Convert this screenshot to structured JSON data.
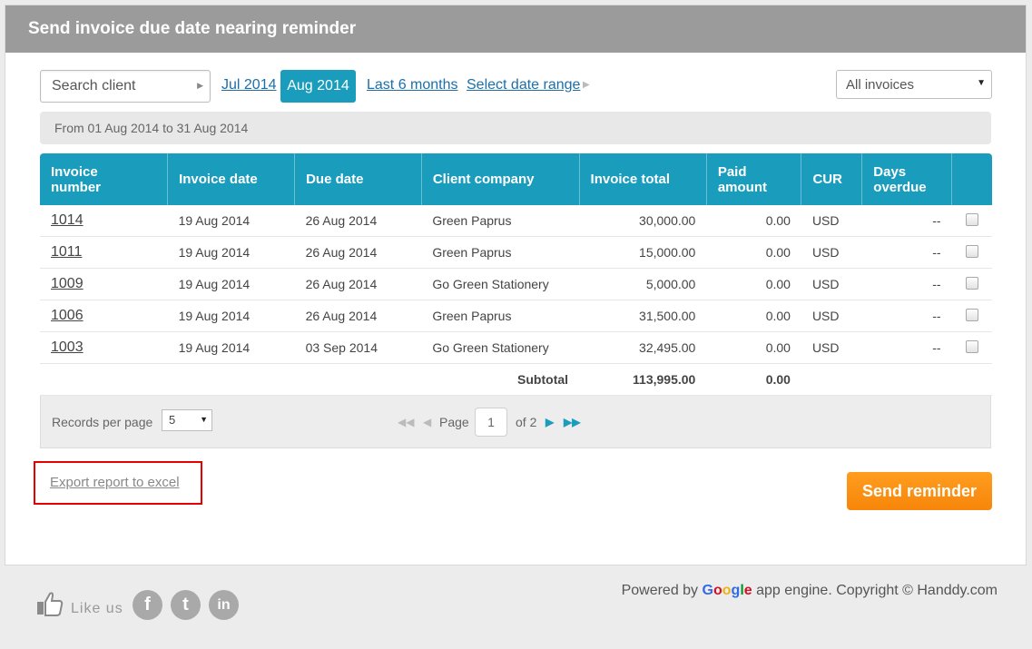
{
  "header": {
    "title": "Send invoice due date nearing reminder"
  },
  "filters": {
    "search_placeholder": "Search client",
    "date_links": {
      "jul": "Jul 2014",
      "aug": "Aug 2014",
      "last6": "Last 6 months",
      "range": "Select date range"
    },
    "invoice_filter": "All invoices",
    "range_text": "From 01 Aug 2014 to 31 Aug 2014"
  },
  "table": {
    "headers": {
      "invoice_number_1": "Invoice",
      "invoice_number_2": "number",
      "invoice_date": "Invoice date",
      "due_date": "Due date",
      "client_company": "Client company",
      "invoice_total": "Invoice total",
      "paid_1": "Paid",
      "paid_2": "amount",
      "cur": "CUR",
      "days_1": "Days",
      "days_2": "overdue"
    },
    "rows": [
      {
        "number": "1014",
        "invoice_date": "19 Aug 2014",
        "due_date": "26 Aug 2014",
        "client": "Green Paprus",
        "total": "30,000.00",
        "paid": "0.00",
        "cur": "USD",
        "days": "--"
      },
      {
        "number": "1011",
        "invoice_date": "19 Aug 2014",
        "due_date": "26 Aug 2014",
        "client": "Green Paprus",
        "total": "15,000.00",
        "paid": "0.00",
        "cur": "USD",
        "days": "--"
      },
      {
        "number": "1009",
        "invoice_date": "19 Aug 2014",
        "due_date": "26 Aug 2014",
        "client": "Go Green Stationery",
        "total": "5,000.00",
        "paid": "0.00",
        "cur": "USD",
        "days": "--"
      },
      {
        "number": "1006",
        "invoice_date": "19 Aug 2014",
        "due_date": "26 Aug 2014",
        "client": "Green Paprus",
        "total": "31,500.00",
        "paid": "0.00",
        "cur": "USD",
        "days": "--"
      },
      {
        "number": "1003",
        "invoice_date": "19 Aug 2014",
        "due_date": "03 Sep 2014",
        "client": "Go Green Stationery",
        "total": "32,495.00",
        "paid": "0.00",
        "cur": "USD",
        "days": "--"
      }
    ],
    "subtotal_label": "Subtotal",
    "subtotal_total": "113,995.00",
    "subtotal_paid": "0.00"
  },
  "pager": {
    "records_label": "Records per page",
    "records_value": "5",
    "page_label": "Page",
    "page_value": "1",
    "of_label": "of 2"
  },
  "actions": {
    "export_label": "Export report to excel",
    "send_label": "Send reminder"
  },
  "footer": {
    "like_label": "Like us",
    "powered_prefix": "Powered by",
    "google": [
      "G",
      "o",
      "o",
      "g",
      "l",
      "e"
    ],
    "powered_suffix": "app engine. Copyright © Handdy.com",
    "social": {
      "facebook": "f",
      "twitter": "t",
      "linkedin": "in"
    }
  },
  "colors": {
    "accent": "#1a9cbd",
    "send_button": "#f7860a",
    "header_bar": "#9b9b9b",
    "highlight_box": "#e60000"
  }
}
